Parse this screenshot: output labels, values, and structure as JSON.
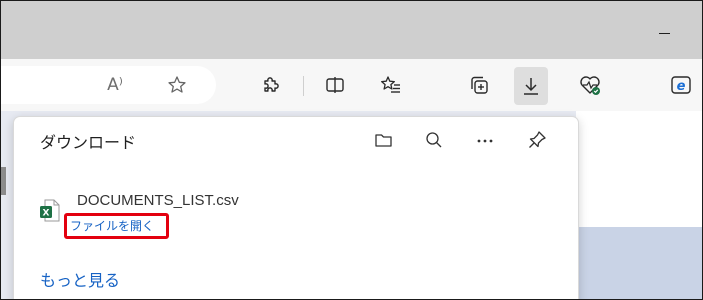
{
  "colors": {
    "titlebar": "#cfcfcf",
    "toolbar": "#f7f7f7",
    "link": "#1662c4",
    "highlight_border": "#e3000f",
    "excel_green": "#1e7145"
  },
  "window": {
    "minimize_icon": "minimize-icon"
  },
  "toolbar": {
    "read_aloud_label": "A⁾",
    "icons": [
      "read-aloud-icon",
      "favorite-star-icon",
      "extensions-icon",
      "split-screen-icon",
      "favorites-icon",
      "collections-icon",
      "downloads-icon",
      "browser-essentials-icon",
      "edge-icon"
    ]
  },
  "downloads": {
    "title": "ダウンロード",
    "actions": [
      "open-downloads-folder-icon",
      "search-downloads-icon",
      "more-options-icon",
      "pin-icon"
    ],
    "items": [
      {
        "file_name": "DOCUMENTS_LIST.csv",
        "action_label": "ファイルを開く",
        "icon": "excel-csv-file-icon"
      }
    ],
    "show_more_label": "もっと見る"
  }
}
